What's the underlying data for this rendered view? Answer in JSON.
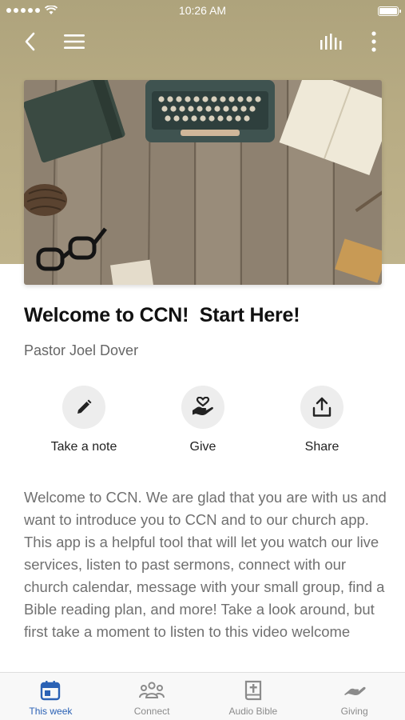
{
  "status_bar": {
    "time": "10:26 AM"
  },
  "nav": {
    "back_icon": "chevron-left-icon",
    "menu_icon": "hamburger-icon",
    "audio_icon": "audio-bars-icon",
    "more_icon": "more-vertical-icon"
  },
  "header": {
    "title": "Welcome to CCN!  Start Here!",
    "author": "Pastor Joel Dover"
  },
  "actions": [
    {
      "label": "Take a note",
      "icon": "pencil-icon"
    },
    {
      "label": "Give",
      "icon": "hand-heart-icon"
    },
    {
      "label": "Share",
      "icon": "share-icon"
    }
  ],
  "body": {
    "text": "Welcome to CCN.  We are glad that you are with us and want to introduce you to CCN and to our church app.  This app is a helpful tool that will let you watch our live services, listen to past sermons, connect with our church calendar, message with your small group, find a Bible reading plan, and more!  Take a look around, but first take a moment to listen to this video welcome"
  },
  "tabs": [
    {
      "label": "This week",
      "icon": "calendar-icon",
      "active": true
    },
    {
      "label": "Connect",
      "icon": "people-icon",
      "active": false
    },
    {
      "label": "Audio Bible",
      "icon": "bible-icon",
      "active": false
    },
    {
      "label": "Giving",
      "icon": "giving-icon",
      "active": false
    }
  ],
  "colors": {
    "accent": "#2b62b5",
    "header_bg": "#b4a880",
    "tab_inactive": "#8b8b8b"
  }
}
